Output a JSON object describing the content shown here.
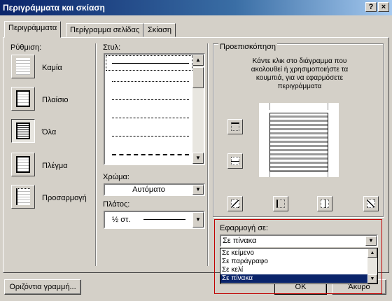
{
  "window": {
    "title": "Περιγράμματα και σκίαση",
    "help_btn": "?",
    "close_btn": "×"
  },
  "tabs": [
    {
      "label": "Περιγράμματα",
      "active": true
    },
    {
      "label": "Περίγραμμα σελίδας",
      "active": false
    },
    {
      "label": "Σκίαση",
      "active": false
    }
  ],
  "settings": {
    "label": "Ρύθμιση:",
    "items": [
      {
        "label": "Καμία"
      },
      {
        "label": "Πλαίσιο"
      },
      {
        "label": "Όλα",
        "selected": true
      },
      {
        "label": "Πλέγμα"
      },
      {
        "label": "Προσαρμογή"
      }
    ]
  },
  "style": {
    "label": "Στυλ:"
  },
  "color": {
    "label": "Χρώμα:",
    "value": "Αυτόματο"
  },
  "width": {
    "label": "Πλάτος:",
    "value": "½ στ."
  },
  "preview": {
    "label": "Προεπισκόπηση",
    "instructions": "Κάντε κλικ στο διάγραμμα που ακολουθεί ή χρησιμοποιήστε τα κουμπιά, για να εφαρμόσετε περιγράμματα"
  },
  "apply_to": {
    "label": "Εφαρμογή σε:",
    "value": "Σε πίνακα",
    "options": [
      "Σε κείμενο",
      "Σε παράγραφο",
      "Σε κελί",
      "Σε πίνακα"
    ]
  },
  "buttons": {
    "horizontal_line": "Οριζόντια γραμμή...",
    "ok": "ΟΚ",
    "cancel": "Άκυρο"
  }
}
